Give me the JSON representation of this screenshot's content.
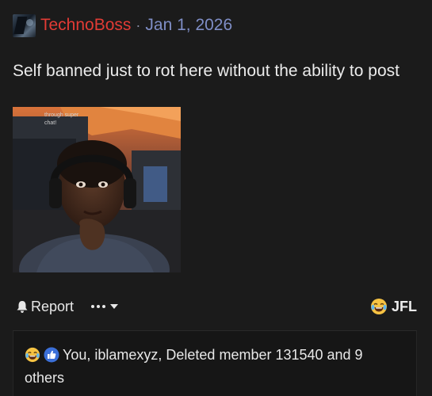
{
  "post": {
    "author": "TechnoBoss",
    "separator": "·",
    "date": "Jan 1, 2026",
    "body": "Self banned just to rot here without the ability to post",
    "media": {
      "caption": "through super chat!"
    }
  },
  "actions": {
    "report_label": "Report",
    "reaction_label": "JFL"
  },
  "reactions": {
    "summary": "You, iblamexyz, Deleted member 131540 and 9 others"
  },
  "colors": {
    "username": "#e23b35",
    "date": "#7f8ec6",
    "background": "#1b1b1b",
    "like_blue": "#3b6fd8",
    "emoji_yellow": "#f6c343"
  },
  "icons": {
    "report": "bell-icon",
    "more": "ellipsis-icon",
    "dropdown": "caret-down-icon",
    "reaction": "laughing-crying-emoji-icon",
    "like": "thumbs-up-icon"
  }
}
